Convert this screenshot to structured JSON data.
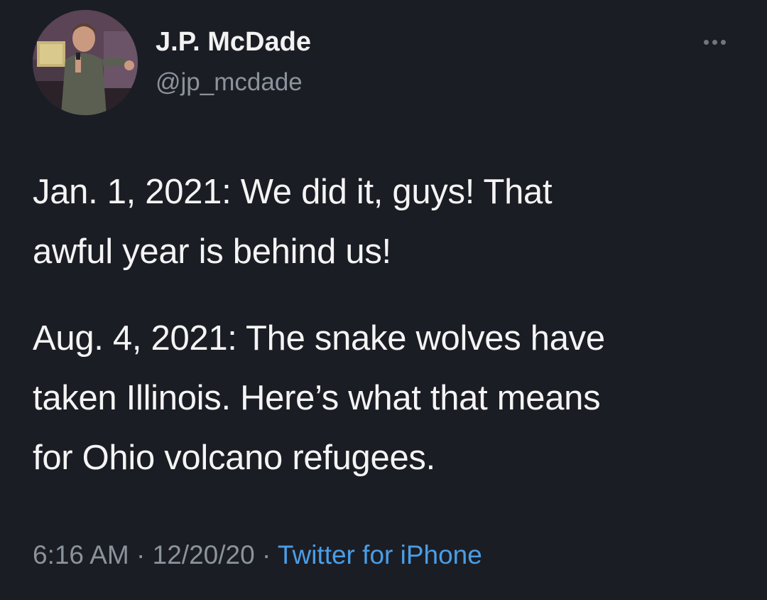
{
  "author": {
    "display_name": "J.P. McDade",
    "handle": "@jp_mcdade",
    "avatar_icon": "profile-photo"
  },
  "more_icon": "more-horizontal-icon",
  "tweet": {
    "paragraph_1": {
      "line_1": "Jan. 1, 2021: We did it, guys! That",
      "line_2": "awful year is behind us!"
    },
    "paragraph_2": {
      "line_1": "Aug. 4, 2021: The snake wolves have",
      "line_2": "taken Illinois. Here’s what that means",
      "line_3": "for Ohio volcano refugees."
    }
  },
  "meta": {
    "time": "6:16 AM",
    "separator": "·",
    "date": "12/20/20",
    "source": "Twitter for iPhone"
  },
  "colors": {
    "background": "#1b1d24",
    "secondary_text": "#8b939c",
    "link": "#4a9ee6"
  }
}
